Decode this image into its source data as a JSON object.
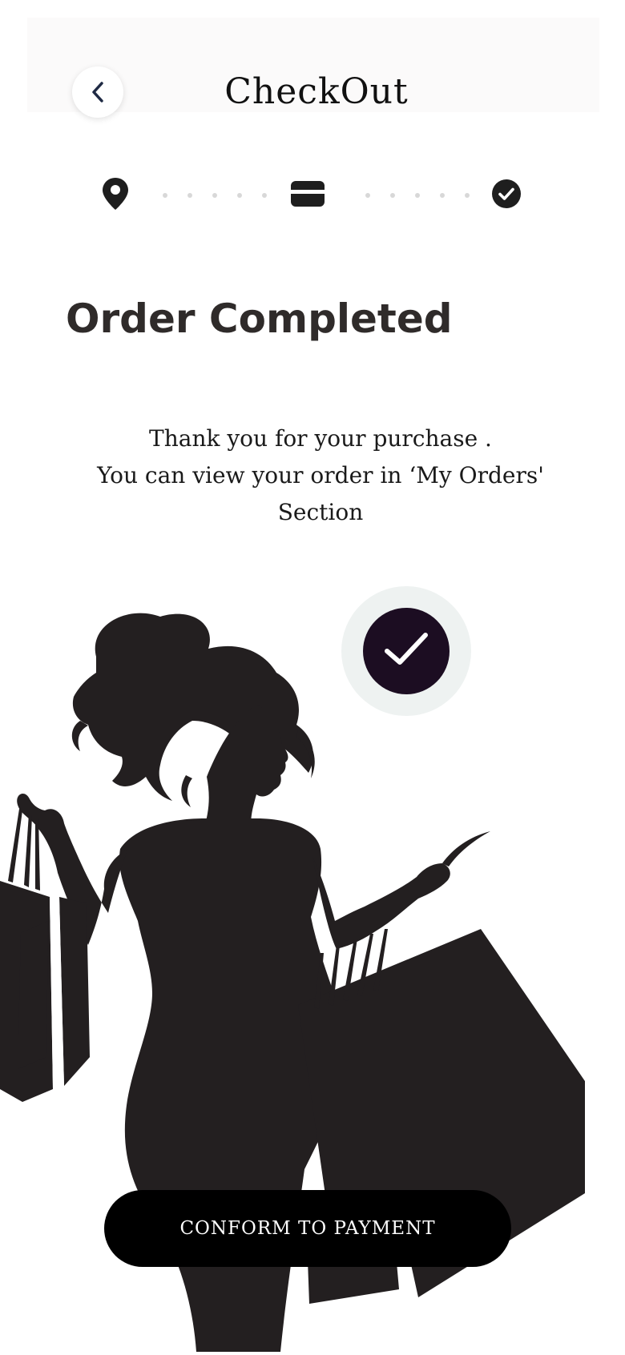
{
  "header": {
    "title": "CheckOut",
    "back_icon": "chevron-left-icon"
  },
  "stepper": {
    "steps": [
      {
        "icon": "location-pin-icon",
        "state": "done"
      },
      {
        "icon": "credit-card-icon",
        "state": "done"
      },
      {
        "icon": "check-circle-icon",
        "state": "current"
      }
    ]
  },
  "content": {
    "heading": "Order Completed",
    "message_lines": [
      "Thank you for your purchase .",
      "You can view your order in ‘My Orders'",
      "Section"
    ]
  },
  "illustration": {
    "description_icon": "woman-shopping-bags-silhouette",
    "badge_icon": "checkmark-icon"
  },
  "cta": {
    "label": "CONFORM TO PAYMENT"
  },
  "colors": {
    "primary": "#000000",
    "badge_dark": "#1c0d22",
    "badge_light": "#eef2f1",
    "text_dark": "#2f2b2a",
    "dots": "#d8d8d8"
  }
}
